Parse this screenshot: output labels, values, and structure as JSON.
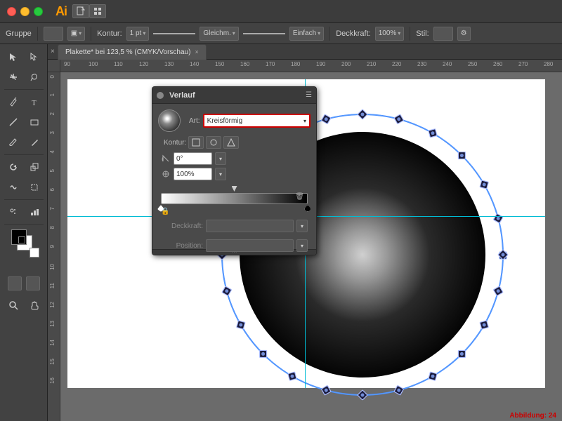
{
  "titlebar": {
    "app_name": "Ai",
    "icons": [
      "file-icon",
      "grid-icon"
    ]
  },
  "toolbar": {
    "group_label": "Gruppe",
    "kontur_label": "Kontur:",
    "stroke_size": "1 pt",
    "gleichm_label": "Gleichm.",
    "einfach_label": "Einfach",
    "deckkraft_label": "Deckkraft:",
    "deckkraft_value": "100%",
    "stil_label": "Stil:"
  },
  "tab": {
    "title": "Plakette* bei 123,5 % (CMYK/Vorschau)"
  },
  "gradient_panel": {
    "title": "Verlauf",
    "art_label": "Art:",
    "art_value": "Kreisförmig",
    "kontur_label": "Kontur:",
    "angle_value": "0°",
    "scale_value": "100%",
    "deckkraft_label": "Deckkraft:",
    "position_label": "Position:"
  },
  "statusbar": {
    "text": "Abbildung: 24"
  },
  "ruler": {
    "ticks": [
      90,
      100,
      110,
      120,
      130,
      140,
      150,
      160,
      170,
      180,
      190,
      200,
      210,
      220,
      230,
      240,
      250,
      260,
      270,
      280
    ],
    "vticks": [
      0,
      1,
      2,
      3,
      4,
      5,
      6,
      7,
      8,
      9,
      10,
      11,
      12,
      13,
      14,
      15,
      16
    ]
  }
}
